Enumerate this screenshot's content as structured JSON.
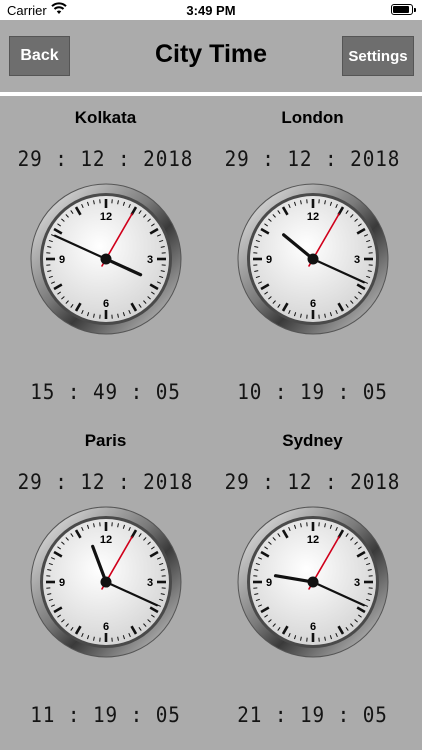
{
  "status_bar": {
    "carrier": "Carrier",
    "time": "3:49 PM"
  },
  "nav": {
    "back_label": "Back",
    "title": "City Time",
    "settings_label": "Settings"
  },
  "cities": [
    {
      "name": "Kolkata",
      "date": "29 : 12 : 2018",
      "time": "15 : 49 : 05",
      "clock": {
        "hour": 3,
        "minute": 49,
        "second": 5
      }
    },
    {
      "name": "London",
      "date": "29 : 12 : 2018",
      "time": "10 : 19 : 05",
      "clock": {
        "hour": 10,
        "minute": 19,
        "second": 5
      }
    },
    {
      "name": "Paris",
      "date": "29 : 12 : 2018",
      "time": "11 : 19 : 05",
      "clock": {
        "hour": 11,
        "minute": 19,
        "second": 5
      }
    },
    {
      "name": "Sydney",
      "date": "29 : 12 : 2018",
      "time": "21 : 19 : 05",
      "clock": {
        "hour": 9,
        "minute": 19,
        "second": 5
      }
    }
  ],
  "clock_numerals": [
    "12",
    "3",
    "6",
    "9"
  ],
  "colors": {
    "background": "#ababab",
    "button": "#6e6e6e",
    "second_hand": "#d0001b"
  }
}
